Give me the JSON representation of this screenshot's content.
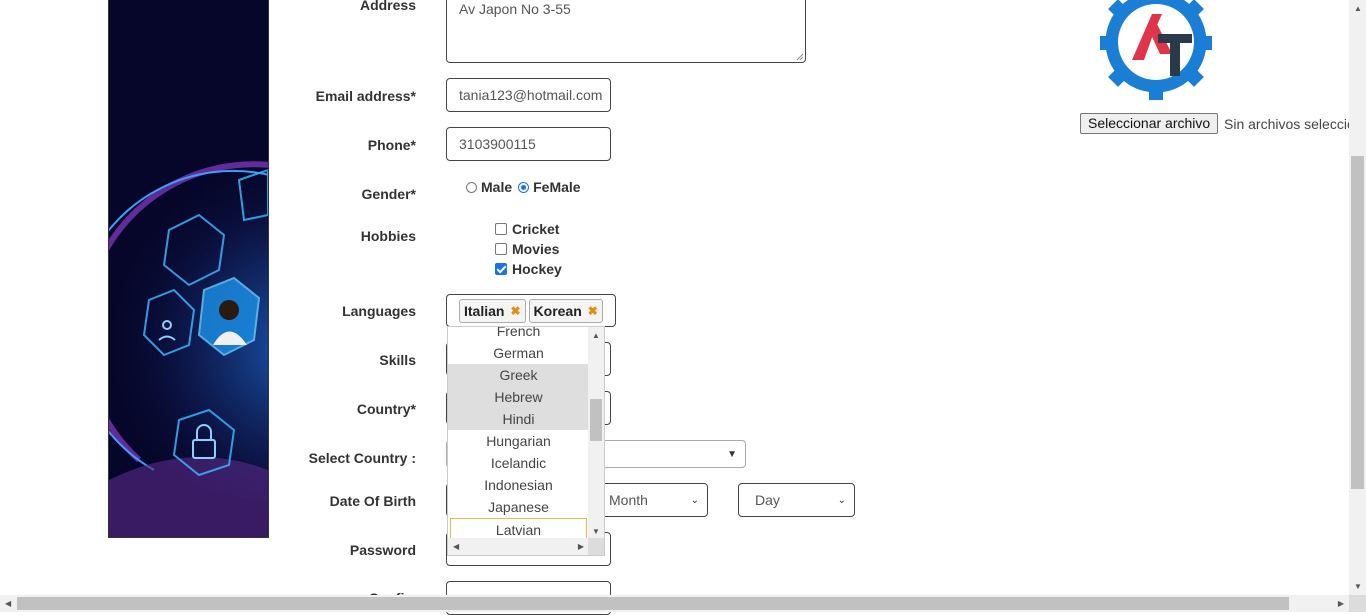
{
  "form": {
    "address_label": "Address",
    "address_value": "Av Japon No 3-55",
    "email_label": "Email address*",
    "email_value": "tania123@hotmail.com",
    "phone_label": "Phone*",
    "phone_value": "3103900115",
    "gender_label": "Gender*",
    "gender_options": [
      "Male",
      "FeMale"
    ],
    "gender_selected": "FeMale",
    "hobbies_label": "Hobbies",
    "hobbies": [
      {
        "label": "Cricket",
        "checked": false
      },
      {
        "label": "Movies",
        "checked": false
      },
      {
        "label": "Hockey",
        "checked": true
      }
    ],
    "languages_label": "Languages",
    "languages_selected": [
      "Italian",
      "Korean"
    ],
    "tag_remove_glyph": "✖",
    "skills_label": "Skills",
    "country_label": "Country*",
    "select_country_label": "Select Country :",
    "dob_label": "Date Of Birth",
    "dob_month": "Month",
    "dob_day": "Day",
    "password_label": "Password",
    "confirm_label_partial": "Confi..."
  },
  "language_dropdown": {
    "options": [
      "French",
      "German",
      "Greek",
      "Hebrew",
      "Hindi",
      "Hungarian",
      "Icelandic",
      "Indonesian",
      "Japanese",
      "Latvian"
    ],
    "highlighted": [
      "Greek",
      "Hebrew",
      "Hindi"
    ],
    "focused": "Latvian"
  },
  "upload": {
    "button_label": "Seleccionar archivo",
    "status_text": "Sin archivos seleccionados"
  },
  "colors": {
    "accent": "#1a73e8",
    "logo_blue": "#1a7fd4",
    "logo_red": "#e0344a",
    "logo_dark": "#2b3a4a",
    "tag_x": "#e88c10"
  },
  "icons": {
    "logo": "automation-testing-gear-logo",
    "banner_person": "person-avatar-icon",
    "banner_lock": "lock-icon",
    "banner_face": "face-icon"
  }
}
